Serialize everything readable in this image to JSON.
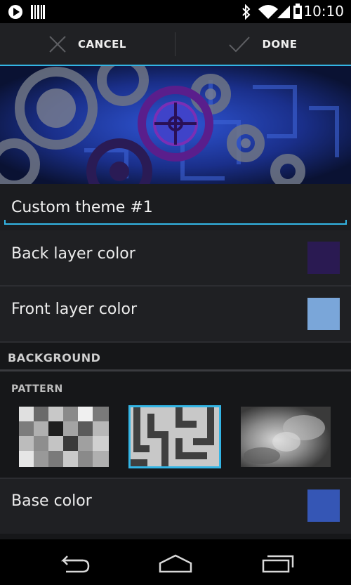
{
  "status_bar": {
    "time": "10:10",
    "icons": [
      "play-store-icon",
      "barcode-icon",
      "bluetooth-icon",
      "wifi-icon",
      "cell-signal-icon",
      "battery-icon"
    ]
  },
  "action_bar": {
    "cancel_label": "CANCEL",
    "done_label": "DONE"
  },
  "theme": {
    "name_value": "Custom theme #1"
  },
  "layers": [
    {
      "label": "Back layer color",
      "color": "#2a1a52"
    },
    {
      "label": "Front layer color",
      "color": "#7aa6d9"
    }
  ],
  "background_section": {
    "header": "BACKGROUND",
    "pattern_label": "PATTERN",
    "patterns": [
      "checker-pattern",
      "maze-pattern",
      "clouds-pattern"
    ],
    "selected_pattern_index": 1,
    "base_color_label": "Base color",
    "base_color": "#3556b5"
  },
  "colors": {
    "accent": "#33b5e5"
  },
  "nav_bar": {
    "icons": [
      "back-icon",
      "home-icon",
      "recents-icon"
    ]
  }
}
